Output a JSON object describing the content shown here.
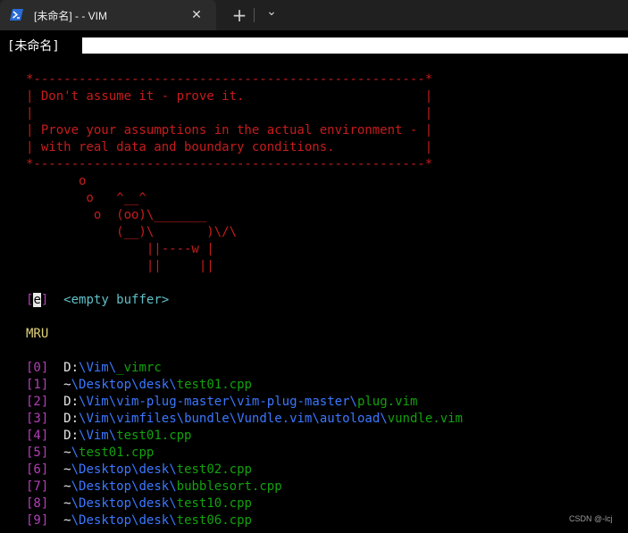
{
  "window": {
    "tab_title": "[未命名] - - VIM",
    "new_tab_glyph": "+",
    "dropdown_glyph": "⌄",
    "close_glyph": "✕"
  },
  "tabline": {
    "label": "[未命名]"
  },
  "cowsay": {
    "lines": [
      "*----------------------------------------------------*",
      "| Don't assume it - prove it.                        |",
      "|                                                    |",
      "| Prove your assumptions in the actual environment - |",
      "| with real data and boundary conditions.            |",
      "*----------------------------------------------------*",
      "       o",
      "        o   ^__^",
      "         o  (oo)\\_______",
      "            (__)\\       )\\/\\",
      "                ||----w |",
      "                ||     ||"
    ]
  },
  "empty_buffer": {
    "key_open": "[",
    "key_char": "e",
    "key_close": "]",
    "label": "<empty buffer>"
  },
  "mru": {
    "heading": "MRU",
    "items": [
      {
        "index": "[0]",
        "parts": [
          [
            "drive",
            "D:"
          ],
          [
            "sep",
            "\\"
          ],
          [
            "dir",
            "Vim"
          ],
          [
            "sep",
            "\\"
          ],
          [
            "file",
            "_vimrc"
          ]
        ]
      },
      {
        "index": "[1]",
        "parts": [
          [
            "tilde",
            "~"
          ],
          [
            "sep",
            "\\"
          ],
          [
            "dir",
            "Desktop"
          ],
          [
            "sep",
            "\\"
          ],
          [
            "dir",
            "desk"
          ],
          [
            "sep",
            "\\"
          ],
          [
            "file",
            "test01.cpp"
          ]
        ]
      },
      {
        "index": "[2]",
        "parts": [
          [
            "drive",
            "D:"
          ],
          [
            "sep",
            "\\"
          ],
          [
            "dir",
            "Vim"
          ],
          [
            "sep",
            "\\"
          ],
          [
            "dir",
            "vim-plug-master"
          ],
          [
            "sep",
            "\\"
          ],
          [
            "dir",
            "vim-plug-master"
          ],
          [
            "sep",
            "\\"
          ],
          [
            "file",
            "plug.vim"
          ]
        ]
      },
      {
        "index": "[3]",
        "parts": [
          [
            "drive",
            "D:"
          ],
          [
            "sep",
            "\\"
          ],
          [
            "dir",
            "Vim"
          ],
          [
            "sep",
            "\\"
          ],
          [
            "dir",
            "vimfiles"
          ],
          [
            "sep",
            "\\"
          ],
          [
            "dir",
            "bundle"
          ],
          [
            "sep",
            "\\"
          ],
          [
            "dir",
            "Vundle.vim"
          ],
          [
            "sep",
            "\\"
          ],
          [
            "dir",
            "autoload"
          ],
          [
            "sep",
            "\\"
          ],
          [
            "file",
            "vundle.vim"
          ]
        ]
      },
      {
        "index": "[4]",
        "parts": [
          [
            "drive",
            "D:"
          ],
          [
            "sep",
            "\\"
          ],
          [
            "dir",
            "Vim"
          ],
          [
            "sep",
            "\\"
          ],
          [
            "file",
            "test01.cpp"
          ]
        ]
      },
      {
        "index": "[5]",
        "parts": [
          [
            "tilde",
            "~"
          ],
          [
            "sep",
            "\\"
          ],
          [
            "file",
            "test01.cpp"
          ]
        ]
      },
      {
        "index": "[6]",
        "parts": [
          [
            "tilde",
            "~"
          ],
          [
            "sep",
            "\\"
          ],
          [
            "dir",
            "Desktop"
          ],
          [
            "sep",
            "\\"
          ],
          [
            "dir",
            "desk"
          ],
          [
            "sep",
            "\\"
          ],
          [
            "file",
            "test02.cpp"
          ]
        ]
      },
      {
        "index": "[7]",
        "parts": [
          [
            "tilde",
            "~"
          ],
          [
            "sep",
            "\\"
          ],
          [
            "dir",
            "Desktop"
          ],
          [
            "sep",
            "\\"
          ],
          [
            "dir",
            "desk"
          ],
          [
            "sep",
            "\\"
          ],
          [
            "file",
            "bubblesort.cpp"
          ]
        ]
      },
      {
        "index": "[8]",
        "parts": [
          [
            "tilde",
            "~"
          ],
          [
            "sep",
            "\\"
          ],
          [
            "dir",
            "Desktop"
          ],
          [
            "sep",
            "\\"
          ],
          [
            "dir",
            "desk"
          ],
          [
            "sep",
            "\\"
          ],
          [
            "file",
            "test10.cpp"
          ]
        ]
      },
      {
        "index": "[9]",
        "parts": [
          [
            "tilde",
            "~"
          ],
          [
            "sep",
            "\\"
          ],
          [
            "dir",
            "Desktop"
          ],
          [
            "sep",
            "\\"
          ],
          [
            "dir",
            "desk"
          ],
          [
            "sep",
            "\\"
          ],
          [
            "file",
            "test06.cpp"
          ]
        ]
      }
    ]
  },
  "watermark": "CSDN @-lcj",
  "colors": {
    "background": "#000000",
    "cowsay_red": "#c61c1c",
    "index_magenta": "#b43fb8",
    "path_blue": "#3b78ff",
    "file_green": "#13a10e",
    "heading_yellow": "#e0d27a",
    "buffer_cyan": "#5fc1c8"
  }
}
